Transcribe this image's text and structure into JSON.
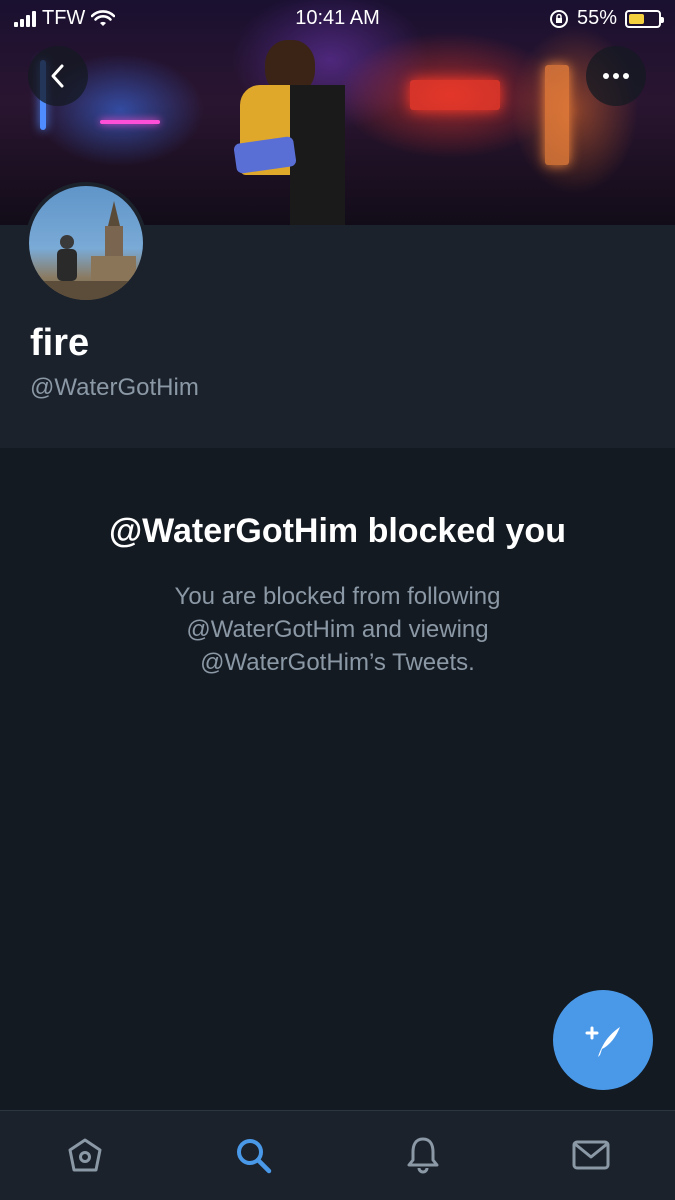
{
  "status_bar": {
    "carrier": "TFW",
    "time": "10:41 AM",
    "battery_percent": "55%",
    "battery_level": 0.55
  },
  "header": {
    "back_icon": "chevron-left-icon",
    "more_icon": "more-horizontal-icon"
  },
  "profile": {
    "display_name": "fire",
    "handle": "@WaterGotHim"
  },
  "blocked_notice": {
    "title": "@WaterGotHim blocked you",
    "description": "You are blocked from following @WaterGotHim and viewing @WaterGotHim’s Tweets."
  },
  "compose": {
    "icon": "compose-tweet-icon"
  },
  "tabbar": {
    "tabs": [
      {
        "name": "home",
        "icon": "home-icon",
        "active": false
      },
      {
        "name": "search",
        "icon": "search-icon",
        "active": true
      },
      {
        "name": "notifications",
        "icon": "bell-icon",
        "active": false
      },
      {
        "name": "messages",
        "icon": "mail-icon",
        "active": false
      }
    ]
  },
  "colors": {
    "background": "#141a22",
    "profile_background": "#1b222c",
    "accent": "#4a99e9",
    "secondary_text": "#8b98a5"
  }
}
